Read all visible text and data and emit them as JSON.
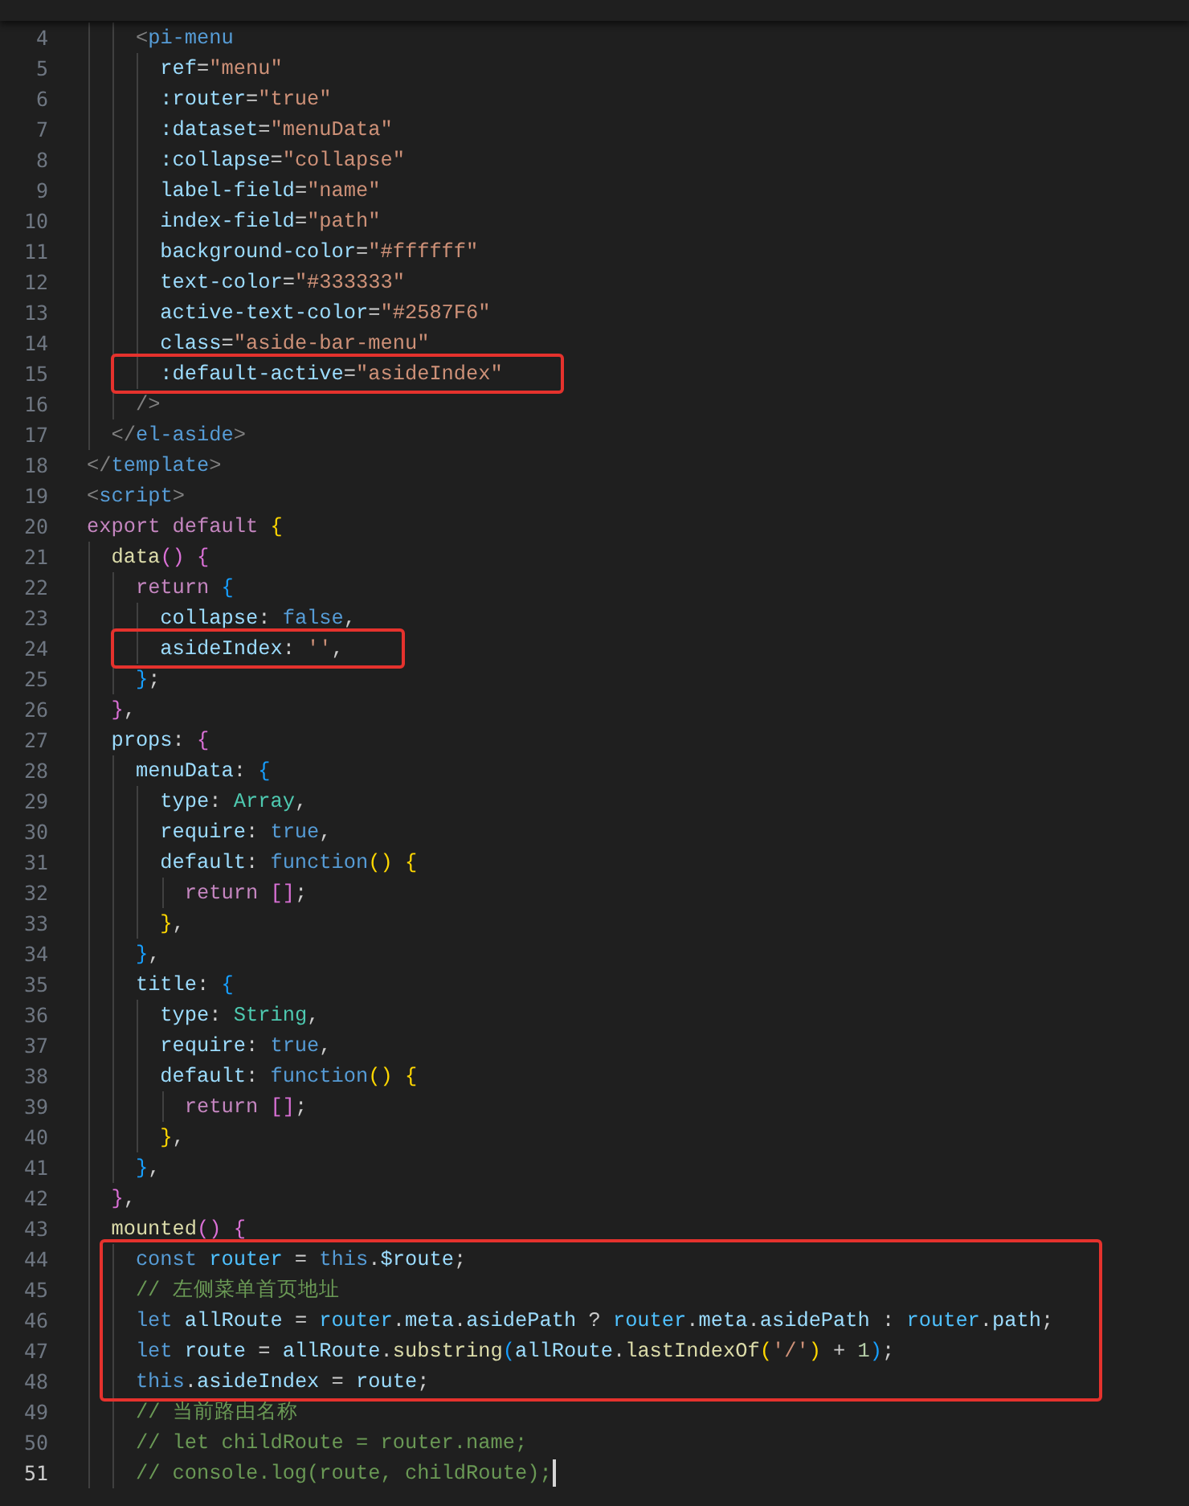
{
  "editor": {
    "code": [
      {
        "kind": "line",
        "number": "4",
        "current": false,
        "tokens": [
          {
            "text": "    <",
            "kind": "p"
          },
          {
            "text": "pi-menu",
            "kind": "tag"
          }
        ]
      },
      {
        "kind": "line",
        "number": "5",
        "current": false,
        "tokens": [
          {
            "text": "      ref",
            "kind": "attr"
          },
          {
            "text": "=",
            "kind": "txt"
          },
          {
            "text": "\"menu\"",
            "kind": "str"
          }
        ]
      },
      {
        "kind": "line",
        "number": "6",
        "current": false,
        "tokens": [
          {
            "text": "      :router",
            "kind": "attr"
          },
          {
            "text": "=",
            "kind": "txt"
          },
          {
            "text": "\"true\"",
            "kind": "str"
          }
        ]
      },
      {
        "kind": "line",
        "number": "7",
        "current": false,
        "tokens": [
          {
            "text": "      :dataset",
            "kind": "attr"
          },
          {
            "text": "=",
            "kind": "txt"
          },
          {
            "text": "\"menuData\"",
            "kind": "str"
          }
        ]
      },
      {
        "kind": "line",
        "number": "8",
        "current": false,
        "tokens": [
          {
            "text": "      :collapse",
            "kind": "attr"
          },
          {
            "text": "=",
            "kind": "txt"
          },
          {
            "text": "\"collapse\"",
            "kind": "str"
          }
        ]
      },
      {
        "kind": "line",
        "number": "9",
        "current": false,
        "tokens": [
          {
            "text": "      label-field",
            "kind": "attr"
          },
          {
            "text": "=",
            "kind": "txt"
          },
          {
            "text": "\"name\"",
            "kind": "str"
          }
        ]
      },
      {
        "kind": "line",
        "number": "10",
        "current": false,
        "tokens": [
          {
            "text": "      index-field",
            "kind": "attr"
          },
          {
            "text": "=",
            "kind": "txt"
          },
          {
            "text": "\"path\"",
            "kind": "str"
          }
        ]
      },
      {
        "kind": "line",
        "number": "11",
        "current": false,
        "tokens": [
          {
            "text": "      background-color",
            "kind": "attr"
          },
          {
            "text": "=",
            "kind": "txt"
          },
          {
            "text": "\"#ffffff\"",
            "kind": "str"
          }
        ]
      },
      {
        "kind": "line",
        "number": "12",
        "current": false,
        "tokens": [
          {
            "text": "      text-color",
            "kind": "attr"
          },
          {
            "text": "=",
            "kind": "txt"
          },
          {
            "text": "\"#333333\"",
            "kind": "str"
          }
        ]
      },
      {
        "kind": "line",
        "number": "13",
        "current": false,
        "tokens": [
          {
            "text": "      active-text-color",
            "kind": "attr"
          },
          {
            "text": "=",
            "kind": "txt"
          },
          {
            "text": "\"#2587F6\"",
            "kind": "str"
          }
        ]
      },
      {
        "kind": "line",
        "number": "14",
        "current": false,
        "tokens": [
          {
            "text": "      class",
            "kind": "attr"
          },
          {
            "text": "=",
            "kind": "txt"
          },
          {
            "text": "\"aside-bar-menu\"",
            "kind": "str"
          }
        ]
      },
      {
        "kind": "highlight",
        "lines": [
          {
            "number": "15",
            "current": false,
            "tokens": [
              {
                "text": "      :default-active",
                "kind": "attr"
              },
              {
                "text": "=",
                "kind": "txt"
              },
              {
                "text": "\"asideIndex\"",
                "kind": "str"
              }
            ]
          }
        ]
      },
      {
        "kind": "line",
        "number": "16",
        "current": false,
        "tokens": [
          {
            "text": "    />",
            "kind": "p"
          }
        ]
      },
      {
        "kind": "line",
        "number": "17",
        "current": false,
        "tokens": [
          {
            "text": "  </",
            "kind": "p"
          },
          {
            "text": "el-aside",
            "kind": "tag"
          },
          {
            "text": ">",
            "kind": "p"
          }
        ]
      },
      {
        "kind": "line",
        "number": "18",
        "current": false,
        "tokens": [
          {
            "text": "</",
            "kind": "p"
          },
          {
            "text": "template",
            "kind": "tag"
          },
          {
            "text": ">",
            "kind": "p"
          }
        ]
      },
      {
        "kind": "line",
        "number": "19",
        "current": false,
        "tokens": [
          {
            "text": "<",
            "kind": "p"
          },
          {
            "text": "script",
            "kind": "tag"
          },
          {
            "text": ">",
            "kind": "p"
          }
        ]
      },
      {
        "kind": "line",
        "number": "20",
        "current": false,
        "tokens": [
          {
            "text": "export default ",
            "kind": "ctl"
          },
          {
            "text": "{",
            "kind": "b1"
          }
        ]
      },
      {
        "kind": "line",
        "number": "21",
        "current": false,
        "tokens": [
          {
            "text": "  data",
            "kind": "fn"
          },
          {
            "text": "() {",
            "kind": "b2"
          }
        ]
      },
      {
        "kind": "line",
        "number": "22",
        "current": false,
        "tokens": [
          {
            "text": "    return ",
            "kind": "ctl"
          },
          {
            "text": "{",
            "kind": "b3"
          }
        ]
      },
      {
        "kind": "line",
        "number": "23",
        "current": false,
        "tokens": [
          {
            "text": "      collapse",
            "kind": "var"
          },
          {
            "text": ": ",
            "kind": "txt"
          },
          {
            "text": "false",
            "kind": "kw"
          },
          {
            "text": ",",
            "kind": "txt"
          }
        ]
      },
      {
        "kind": "highlight",
        "lines": [
          {
            "number": "24",
            "current": false,
            "tokens": [
              {
                "text": "      asideIndex",
                "kind": "var"
              },
              {
                "text": ": ",
                "kind": "txt"
              },
              {
                "text": "''",
                "kind": "str"
              },
              {
                "text": ",",
                "kind": "txt"
              }
            ]
          }
        ]
      },
      {
        "kind": "line",
        "number": "25",
        "current": false,
        "tokens": [
          {
            "text": "    }",
            "kind": "b3"
          },
          {
            "text": ";",
            "kind": "txt"
          }
        ]
      },
      {
        "kind": "line",
        "number": "26",
        "current": false,
        "tokens": [
          {
            "text": "  }",
            "kind": "b2"
          },
          {
            "text": ",",
            "kind": "txt"
          }
        ]
      },
      {
        "kind": "line",
        "number": "27",
        "current": false,
        "tokens": [
          {
            "text": "  props",
            "kind": "var"
          },
          {
            "text": ": ",
            "kind": "txt"
          },
          {
            "text": "{",
            "kind": "b2"
          }
        ]
      },
      {
        "kind": "line",
        "number": "28",
        "current": false,
        "tokens": [
          {
            "text": "    menuData",
            "kind": "var"
          },
          {
            "text": ": ",
            "kind": "txt"
          },
          {
            "text": "{",
            "kind": "b3"
          }
        ]
      },
      {
        "kind": "line",
        "number": "29",
        "current": false,
        "tokens": [
          {
            "text": "      type",
            "kind": "var"
          },
          {
            "text": ": ",
            "kind": "txt"
          },
          {
            "text": "Array",
            "kind": "type"
          },
          {
            "text": ",",
            "kind": "txt"
          }
        ]
      },
      {
        "kind": "line",
        "number": "30",
        "current": false,
        "tokens": [
          {
            "text": "      require",
            "kind": "var"
          },
          {
            "text": ": ",
            "kind": "txt"
          },
          {
            "text": "true",
            "kind": "kw"
          },
          {
            "text": ",",
            "kind": "txt"
          }
        ]
      },
      {
        "kind": "line",
        "number": "31",
        "current": false,
        "tokens": [
          {
            "text": "      default",
            "kind": "var"
          },
          {
            "text": ": ",
            "kind": "txt"
          },
          {
            "text": "function",
            "kind": "kw"
          },
          {
            "text": "() {",
            "kind": "b1"
          }
        ]
      },
      {
        "kind": "line",
        "number": "32",
        "current": false,
        "tokens": [
          {
            "text": "        return ",
            "kind": "ctl"
          },
          {
            "text": "[]",
            "kind": "b2"
          },
          {
            "text": ";",
            "kind": "txt"
          }
        ]
      },
      {
        "kind": "line",
        "number": "33",
        "current": false,
        "tokens": [
          {
            "text": "      }",
            "kind": "b1"
          },
          {
            "text": ",",
            "kind": "txt"
          }
        ]
      },
      {
        "kind": "line",
        "number": "34",
        "current": false,
        "tokens": [
          {
            "text": "    }",
            "kind": "b3"
          },
          {
            "text": ",",
            "kind": "txt"
          }
        ]
      },
      {
        "kind": "line",
        "number": "35",
        "current": false,
        "tokens": [
          {
            "text": "    title",
            "kind": "var"
          },
          {
            "text": ": ",
            "kind": "txt"
          },
          {
            "text": "{",
            "kind": "b3"
          }
        ]
      },
      {
        "kind": "line",
        "number": "36",
        "current": false,
        "tokens": [
          {
            "text": "      type",
            "kind": "var"
          },
          {
            "text": ": ",
            "kind": "txt"
          },
          {
            "text": "String",
            "kind": "type"
          },
          {
            "text": ",",
            "kind": "txt"
          }
        ]
      },
      {
        "kind": "line",
        "number": "37",
        "current": false,
        "tokens": [
          {
            "text": "      require",
            "kind": "var"
          },
          {
            "text": ": ",
            "kind": "txt"
          },
          {
            "text": "true",
            "kind": "kw"
          },
          {
            "text": ",",
            "kind": "txt"
          }
        ]
      },
      {
        "kind": "line",
        "number": "38",
        "current": false,
        "tokens": [
          {
            "text": "      default",
            "kind": "var"
          },
          {
            "text": ": ",
            "kind": "txt"
          },
          {
            "text": "function",
            "kind": "kw"
          },
          {
            "text": "() {",
            "kind": "b1"
          }
        ]
      },
      {
        "kind": "line",
        "number": "39",
        "current": false,
        "tokens": [
          {
            "text": "        return ",
            "kind": "ctl"
          },
          {
            "text": "[]",
            "kind": "b2"
          },
          {
            "text": ";",
            "kind": "txt"
          }
        ]
      },
      {
        "kind": "line",
        "number": "40",
        "current": false,
        "tokens": [
          {
            "text": "      }",
            "kind": "b1"
          },
          {
            "text": ",",
            "kind": "txt"
          }
        ]
      },
      {
        "kind": "line",
        "number": "41",
        "current": false,
        "tokens": [
          {
            "text": "    }",
            "kind": "b3"
          },
          {
            "text": ",",
            "kind": "txt"
          }
        ]
      },
      {
        "kind": "line",
        "number": "42",
        "current": false,
        "tokens": [
          {
            "text": "  }",
            "kind": "b2"
          },
          {
            "text": ",",
            "kind": "txt"
          }
        ]
      },
      {
        "kind": "line",
        "number": "43",
        "current": false,
        "tokens": [
          {
            "text": "  mounted",
            "kind": "fn"
          },
          {
            "text": "() {",
            "kind": "b2"
          }
        ]
      },
      {
        "kind": "highlight",
        "lines": [
          {
            "number": "44",
            "current": false,
            "tokens": [
              {
                "text": "    const ",
                "kind": "kw"
              },
              {
                "text": "router",
                "kind": "cst"
              },
              {
                "text": " = ",
                "kind": "txt"
              },
              {
                "text": "this",
                "kind": "kw"
              },
              {
                "text": ".",
                "kind": "txt"
              },
              {
                "text": "$route",
                "kind": "var"
              },
              {
                "text": ";",
                "kind": "txt"
              }
            ]
          },
          {
            "number": "45",
            "current": false,
            "tokens": [
              {
                "text": "    // 左侧菜单首页地址",
                "kind": "cm"
              }
            ]
          },
          {
            "number": "46",
            "current": false,
            "tokens": [
              {
                "text": "    let ",
                "kind": "kw"
              },
              {
                "text": "allRoute",
                "kind": "var"
              },
              {
                "text": " = ",
                "kind": "txt"
              },
              {
                "text": "router",
                "kind": "cst"
              },
              {
                "text": ".",
                "kind": "txt"
              },
              {
                "text": "meta",
                "kind": "var"
              },
              {
                "text": ".",
                "kind": "txt"
              },
              {
                "text": "asidePath",
                "kind": "var"
              },
              {
                "text": " ? ",
                "kind": "txt"
              },
              {
                "text": "router",
                "kind": "cst"
              },
              {
                "text": ".",
                "kind": "txt"
              },
              {
                "text": "meta",
                "kind": "var"
              },
              {
                "text": ".",
                "kind": "txt"
              },
              {
                "text": "asidePath",
                "kind": "var"
              },
              {
                "text": " : ",
                "kind": "txt"
              },
              {
                "text": "router",
                "kind": "cst"
              },
              {
                "text": ".",
                "kind": "txt"
              },
              {
                "text": "path",
                "kind": "var"
              },
              {
                "text": ";",
                "kind": "txt"
              }
            ]
          },
          {
            "number": "47",
            "current": false,
            "tokens": [
              {
                "text": "    let ",
                "kind": "kw"
              },
              {
                "text": "route",
                "kind": "var"
              },
              {
                "text": " = ",
                "kind": "txt"
              },
              {
                "text": "allRoute",
                "kind": "var"
              },
              {
                "text": ".",
                "kind": "txt"
              },
              {
                "text": "substring",
                "kind": "fn"
              },
              {
                "text": "(",
                "kind": "b3"
              },
              {
                "text": "allRoute",
                "kind": "var"
              },
              {
                "text": ".",
                "kind": "txt"
              },
              {
                "text": "lastIndexOf",
                "kind": "fn"
              },
              {
                "text": "(",
                "kind": "b1"
              },
              {
                "text": "'/'",
                "kind": "str"
              },
              {
                "text": ")",
                "kind": "b1"
              },
              {
                "text": " + ",
                "kind": "txt"
              },
              {
                "text": "1",
                "kind": "num"
              },
              {
                "text": ")",
                "kind": "b3"
              },
              {
                "text": ";",
                "kind": "txt"
              }
            ]
          },
          {
            "number": "48",
            "current": false,
            "tokens": [
              {
                "text": "    this",
                "kind": "kw"
              },
              {
                "text": ".",
                "kind": "txt"
              },
              {
                "text": "asideIndex",
                "kind": "var"
              },
              {
                "text": " = ",
                "kind": "txt"
              },
              {
                "text": "route",
                "kind": "var"
              },
              {
                "text": ";",
                "kind": "txt"
              }
            ]
          }
        ]
      },
      {
        "kind": "line",
        "number": "49",
        "current": false,
        "tokens": [
          {
            "text": "    // 当前路由名称",
            "kind": "cm"
          }
        ]
      },
      {
        "kind": "line",
        "number": "50",
        "current": false,
        "tokens": [
          {
            "text": "    // let childRoute = router.name;",
            "kind": "cm"
          }
        ]
      },
      {
        "kind": "line",
        "number": "51",
        "current": true,
        "tokens": [
          {
            "text": "    // console.log(route, childRoute);",
            "kind": "cm"
          }
        ]
      }
    ]
  }
}
